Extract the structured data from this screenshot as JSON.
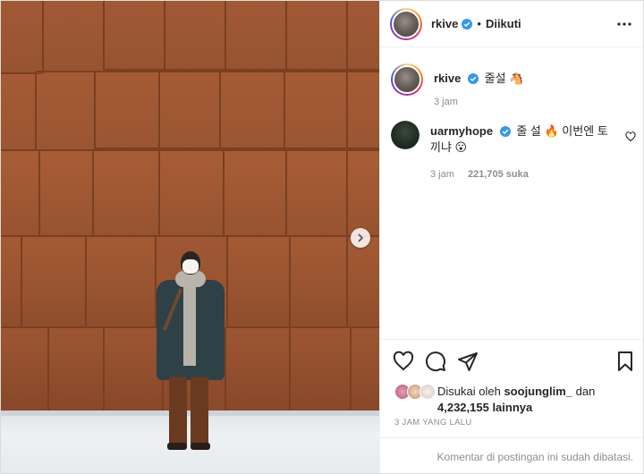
{
  "post": {
    "author": "rkive",
    "follow_status": "Diikuti",
    "separator": "•"
  },
  "caption": {
    "username": "rkive",
    "text": "줄설 🐴",
    "time": "3 jam"
  },
  "comment": {
    "username": "uarmyhope",
    "text": "줄 설 🔥 이번엔 토끼냐 😮",
    "time": "3 jam",
    "likes": "221,705 suka"
  },
  "likes": {
    "prefix": "Disukai oleh",
    "user": "soojunglim_",
    "and": "dan",
    "others": "4,232,155 lainnya"
  },
  "posted_time": "3 JAM YANG LALU",
  "comments_disabled": "Komentar di postingan ini sudah dibatasi.",
  "icons": [
    "verified-badge-icon",
    "more-options-icon",
    "heart-icon",
    "comment-icon",
    "share-icon",
    "bookmark-icon",
    "chevron-right-icon"
  ],
  "colors": {
    "verified": "#3897f0",
    "muted": "#8e8e8e",
    "text": "#262626",
    "border": "#efefef"
  }
}
